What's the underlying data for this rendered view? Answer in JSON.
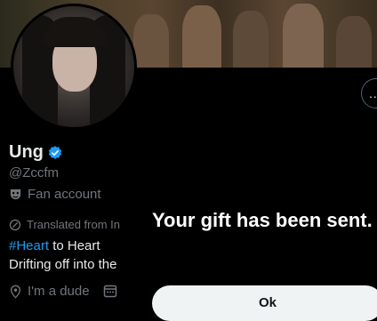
{
  "profile": {
    "display_name": "Ung",
    "handle": "@Zccfm",
    "category": "Fan account",
    "translated_label": "Translated from In",
    "bio_hashtag": "#Heart",
    "bio_line1_rest": " to Heart",
    "bio_line2": "Drifting off into the",
    "location": "I'm a dude"
  },
  "more_button": {
    "label": "..."
  },
  "toast": {
    "message": "Your gift has been sent.",
    "ok_label": "Ok"
  },
  "colors": {
    "background": "#000000",
    "link": "#1d9bf0",
    "verified": "#1d9bf0",
    "secondary_text": "#71767b",
    "button_bg": "#eff3f4"
  },
  "icons": [
    "verified-badge-icon",
    "mask-icon",
    "translate-icon",
    "location-pin-icon",
    "calendar-icon",
    "more-options-icon"
  ]
}
